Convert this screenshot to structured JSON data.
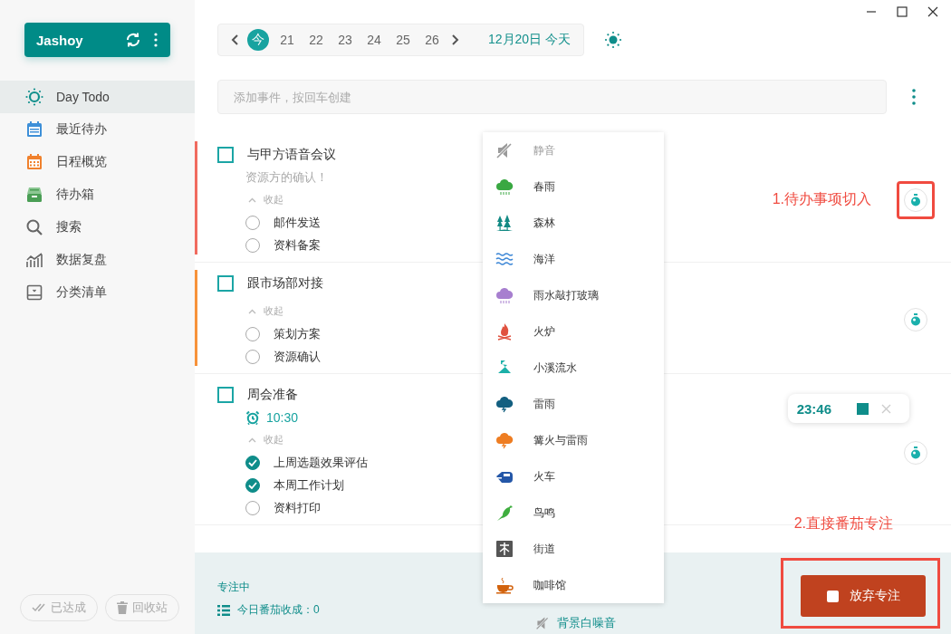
{
  "sidebar": {
    "account": {
      "name": "Jashoy"
    },
    "nav": [
      {
        "label": "Day Todo",
        "selected": true
      },
      {
        "label": "最近待办",
        "selected": false
      },
      {
        "label": "日程概览",
        "selected": false
      },
      {
        "label": "待办箱",
        "selected": false
      },
      {
        "label": "搜索",
        "selected": false
      },
      {
        "label": "数据复盘",
        "selected": false
      },
      {
        "label": "分类清单",
        "selected": false
      }
    ],
    "footer_buttons": [
      "已达成",
      "回收站"
    ]
  },
  "date_strip": {
    "days": [
      {
        "label": "今",
        "selected": true
      },
      {
        "label": "21",
        "selected": false
      },
      {
        "label": "22",
        "selected": false
      },
      {
        "label": "23",
        "selected": false
      },
      {
        "label": "24",
        "selected": false
      },
      {
        "label": "25",
        "selected": false
      },
      {
        "label": "26",
        "selected": false
      }
    ],
    "current_date": "12月20日 今天"
  },
  "add_event": {
    "placeholder": "添加事件，按回车创建"
  },
  "tasks": [
    {
      "title": "与甲方语音会议",
      "checked": false,
      "color": "#f06b5f",
      "note": "资源方的确认！",
      "collapse_label": "收起",
      "highlighted": true,
      "callout": "1.待办事项切入",
      "subtasks": [
        {
          "label": "邮件发送",
          "checked": false
        },
        {
          "label": "资料备案",
          "checked": false
        }
      ]
    },
    {
      "title": "跟市场部对接",
      "checked": false,
      "color": "#f7923a",
      "collapse_label": "收起",
      "highlighted": false,
      "subtasks": [
        {
          "label": "策划方案",
          "checked": false
        },
        {
          "label": "资源确认",
          "checked": false
        }
      ]
    },
    {
      "title": "周会准备",
      "checked": false,
      "reminder": "10:30",
      "collapse_label": "收起",
      "highlighted": false,
      "timer": "23:46",
      "subtasks": [
        {
          "label": "上周选题效果评估",
          "checked": true
        },
        {
          "label": "本周工作计划",
          "checked": true
        },
        {
          "label": "资料打印",
          "checked": false
        }
      ]
    }
  ],
  "sound_menu": [
    {
      "label": "静音",
      "selected": true
    },
    {
      "label": "春雨",
      "selected": false
    },
    {
      "label": "森林",
      "selected": false
    },
    {
      "label": "海洋",
      "selected": false
    },
    {
      "label": "雨水敲打玻璃",
      "selected": false
    },
    {
      "label": "火炉",
      "selected": false
    },
    {
      "label": "小溪流水",
      "selected": false
    },
    {
      "label": "雷雨",
      "selected": false
    },
    {
      "label": "篝火与雷雨",
      "selected": false
    },
    {
      "label": "火车",
      "selected": false
    },
    {
      "label": "鸟鸣",
      "selected": false
    },
    {
      "label": "街道",
      "selected": false
    },
    {
      "label": "咖啡馆",
      "selected": false
    }
  ],
  "focus_bar": {
    "status": "专注中",
    "harvest": "今日番茄收成：0",
    "sound_label": "背景白噪音",
    "callout": "2.直接番茄专注",
    "highlighted": true,
    "stop_button": "放弃专注"
  }
}
